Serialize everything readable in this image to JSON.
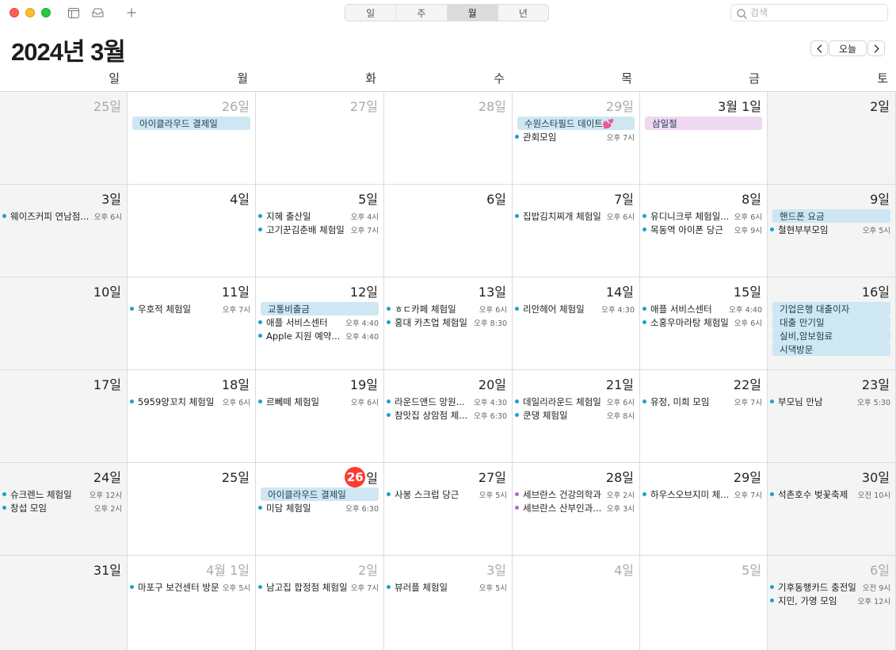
{
  "toolbar": {
    "views": [
      "일",
      "주",
      "월",
      "년"
    ],
    "active_view_index": 2,
    "search_placeholder": "검색"
  },
  "header": {
    "month_title": "2024년 3월",
    "today_label": "오늘"
  },
  "weekdays": [
    "일",
    "월",
    "화",
    "수",
    "목",
    "금",
    "토"
  ],
  "weeks": [
    [
      {
        "label": "25일",
        "muted": true,
        "events": []
      },
      {
        "label": "26일",
        "muted": true,
        "events": [
          {
            "kind": "bar",
            "title": "아이클라우드 결제일"
          }
        ]
      },
      {
        "label": "27일",
        "muted": true,
        "events": []
      },
      {
        "label": "28일",
        "muted": true,
        "events": []
      },
      {
        "label": "29일",
        "muted": true,
        "events": [
          {
            "kind": "bar",
            "title": "수원스타필드 데이트💕"
          },
          {
            "kind": "dot",
            "title": "관회모임",
            "time": "오후 7시"
          }
        ]
      },
      {
        "label": "3월 1일",
        "muted": false,
        "events": [
          {
            "kind": "bar",
            "color": "pink",
            "title": "삼일절"
          }
        ]
      },
      {
        "label": "2일",
        "muted": false,
        "events": []
      }
    ],
    [
      {
        "label": "3일",
        "muted": false,
        "events": [
          {
            "kind": "dot",
            "title": "웨이즈커피 연남점...",
            "time": "오후 6시"
          }
        ]
      },
      {
        "label": "4일",
        "muted": false,
        "events": []
      },
      {
        "label": "5일",
        "muted": false,
        "events": [
          {
            "kind": "dot",
            "title": "지혜 출산일",
            "time": "오후 4시"
          },
          {
            "kind": "dot",
            "title": "고기꾼김춘배 체험일",
            "time": "오후 7시"
          }
        ]
      },
      {
        "label": "6일",
        "muted": false,
        "events": []
      },
      {
        "label": "7일",
        "muted": false,
        "events": [
          {
            "kind": "dot",
            "title": "집밥김치찌개 체험일",
            "time": "오후 6시"
          }
        ]
      },
      {
        "label": "8일",
        "muted": false,
        "events": [
          {
            "kind": "dot",
            "title": "유디니크루 체험일...",
            "time": "오후 6시"
          },
          {
            "kind": "dot",
            "title": "목동역 아이폰 당근",
            "time": "오후 9시"
          }
        ]
      },
      {
        "label": "9일",
        "muted": false,
        "events": [
          {
            "kind": "bar",
            "title": "핸드폰 요금"
          },
          {
            "kind": "dot",
            "title": "철현부부모임",
            "time": "오후 5시"
          }
        ]
      }
    ],
    [
      {
        "label": "10일",
        "muted": false,
        "events": []
      },
      {
        "label": "11일",
        "muted": false,
        "events": [
          {
            "kind": "dot",
            "title": "우호적 체험일",
            "time": "오후 7시"
          }
        ]
      },
      {
        "label": "12일",
        "muted": false,
        "events": [
          {
            "kind": "bar",
            "title": "교통비출금"
          },
          {
            "kind": "dot",
            "title": "애플 서비스센터",
            "time": "오후 4:40"
          },
          {
            "kind": "dot",
            "title": "Apple 지원 예약...",
            "time": "오후 4:40"
          }
        ]
      },
      {
        "label": "13일",
        "muted": false,
        "events": [
          {
            "kind": "dot",
            "title": "ㅎㄷ카페 체험일",
            "time": "오후 6시"
          },
          {
            "kind": "dot",
            "title": "홍대 카츠업 체험일",
            "time": "오후 8:30"
          }
        ]
      },
      {
        "label": "14일",
        "muted": false,
        "events": [
          {
            "kind": "dot",
            "title": "리안헤어 체험일",
            "time": "오후 4:30"
          }
        ]
      },
      {
        "label": "15일",
        "muted": false,
        "events": [
          {
            "kind": "dot",
            "title": "애플 서비스센터",
            "time": "오후 4:40"
          },
          {
            "kind": "dot",
            "title": "소홍우마라탕 체험일",
            "time": "오후 6시"
          }
        ]
      },
      {
        "label": "16일",
        "muted": false,
        "events": [
          {
            "kind": "bar",
            "title": "기업은행 대출이자"
          },
          {
            "kind": "bar",
            "title": "대출 만기일"
          },
          {
            "kind": "bar",
            "title": "실비,암보험료"
          },
          {
            "kind": "bar",
            "title": "시댁방문"
          }
        ]
      }
    ],
    [
      {
        "label": "17일",
        "muted": false,
        "events": []
      },
      {
        "label": "18일",
        "muted": false,
        "events": [
          {
            "kind": "dot",
            "title": "5959양꼬치 체험일",
            "time": "오후 6시"
          }
        ]
      },
      {
        "label": "19일",
        "muted": false,
        "events": [
          {
            "kind": "dot",
            "title": "르뻬떼 체험일",
            "time": "오후 6시"
          }
        ]
      },
      {
        "label": "20일",
        "muted": false,
        "events": [
          {
            "kind": "dot",
            "title": "라운드앤드 망원...",
            "time": "오후 4:30"
          },
          {
            "kind": "dot",
            "title": "참맛집 상암점 체...",
            "time": "오후 6:30"
          }
        ]
      },
      {
        "label": "21일",
        "muted": false,
        "events": [
          {
            "kind": "dot",
            "title": "데일리라운드 체험일",
            "time": "오후 6시"
          },
          {
            "kind": "dot",
            "title": "쿤댕 체험일",
            "time": "오후 8시"
          }
        ]
      },
      {
        "label": "22일",
        "muted": false,
        "events": [
          {
            "kind": "dot",
            "title": "유정, 미희 모임",
            "time": "오후 7시"
          }
        ]
      },
      {
        "label": "23일",
        "muted": false,
        "events": [
          {
            "kind": "dot",
            "title": "부모님 만남",
            "time": "오후 5:30"
          }
        ]
      }
    ],
    [
      {
        "label": "24일",
        "muted": false,
        "events": [
          {
            "kind": "dot",
            "title": "슈크렌느 체험일",
            "time": "오후 12시"
          },
          {
            "kind": "dot",
            "title": "창섭 모임",
            "time": "오후 2시"
          }
        ]
      },
      {
        "label": "25일",
        "muted": false,
        "events": []
      },
      {
        "label": "일",
        "today": "26",
        "muted": false,
        "events": [
          {
            "kind": "bar",
            "title": "아이클라우드 결제일"
          },
          {
            "kind": "dot",
            "title": "미담 체험일",
            "time": "오후 6:30"
          }
        ]
      },
      {
        "label": "27일",
        "muted": false,
        "events": [
          {
            "kind": "dot",
            "title": "사봉 스크럽 당근",
            "time": "오후 5시"
          }
        ]
      },
      {
        "label": "28일",
        "muted": false,
        "events": [
          {
            "kind": "dot",
            "color": "purple",
            "title": "세브란스 건강의학과",
            "time": "오후 2시"
          },
          {
            "kind": "dot",
            "color": "purple",
            "title": "세브란스 산부인과...",
            "time": "오후 3시"
          }
        ]
      },
      {
        "label": "29일",
        "muted": false,
        "events": [
          {
            "kind": "dot",
            "title": "하우스오브지미 체...",
            "time": "오후 7시"
          }
        ]
      },
      {
        "label": "30일",
        "muted": false,
        "events": [
          {
            "kind": "dot",
            "title": "석촌호수 벚꽃축제",
            "time": "오전 10시"
          }
        ]
      }
    ],
    [
      {
        "label": "31일",
        "muted": false,
        "events": []
      },
      {
        "label": "4월 1일",
        "muted": true,
        "events": [
          {
            "kind": "dot",
            "title": "마포구 보건센터 방문",
            "time": "오후 5시"
          }
        ]
      },
      {
        "label": "2일",
        "muted": true,
        "events": [
          {
            "kind": "dot",
            "title": "남고집 합정점 체험일",
            "time": "오후 7시"
          }
        ]
      },
      {
        "label": "3일",
        "muted": true,
        "events": [
          {
            "kind": "dot",
            "title": "뷰러플 체험일",
            "time": "오후 5시"
          }
        ]
      },
      {
        "label": "4일",
        "muted": true,
        "events": []
      },
      {
        "label": "5일",
        "muted": true,
        "events": []
      },
      {
        "label": "6일",
        "muted": true,
        "events": [
          {
            "kind": "dot",
            "title": "기후동행카드 충전일",
            "time": "오전 9시"
          },
          {
            "kind": "dot",
            "title": "지민, 가영 모임",
            "time": "오후 12시"
          }
        ]
      }
    ]
  ]
}
